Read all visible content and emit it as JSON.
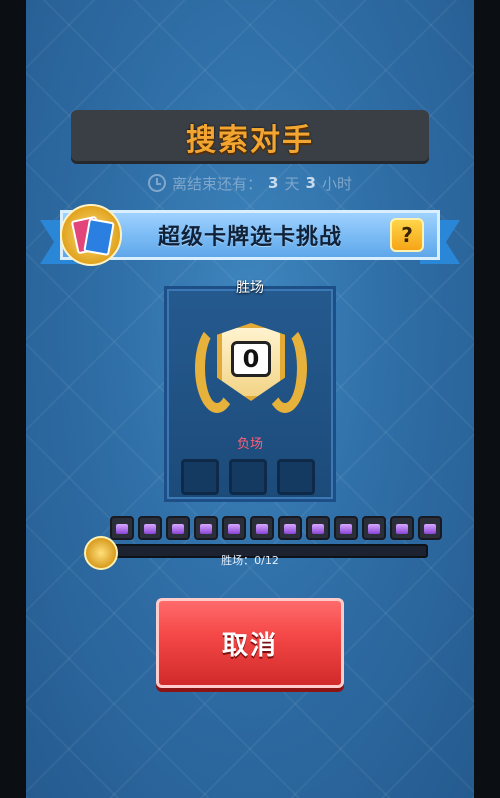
{
  "header": {
    "title": "搜索对手"
  },
  "timer": {
    "prefix": "离结束还有：",
    "days": "3",
    "days_unit": "天",
    "hours": "3",
    "hours_unit": "小时"
  },
  "challenge": {
    "name": "超级卡牌选卡挑战",
    "help_label": "?"
  },
  "panel": {
    "wins_label": "胜场",
    "wins_value": "0",
    "losses_label": "负场",
    "loss_slots": 3
  },
  "progress": {
    "label": "胜场：0/12",
    "current": 0,
    "total": 12,
    "chest_count": 12
  },
  "actions": {
    "cancel_label": "取消"
  },
  "colors": {
    "title": "#f3a532",
    "cancel": "#f54848",
    "ribbon": "#7cbcf5",
    "loss_label": "#ff5f76"
  }
}
